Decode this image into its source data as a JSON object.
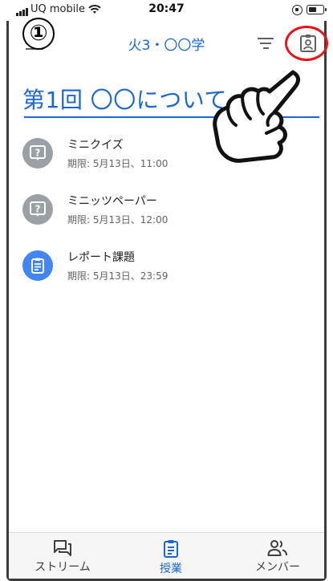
{
  "status_bar": {
    "carrier": "UQ mobile",
    "time": "20:47"
  },
  "annotation": {
    "step_number": "①"
  },
  "app_bar": {
    "class_title": "火3・〇〇学"
  },
  "topic": {
    "title": "第1回 〇〇について"
  },
  "assignments": [
    {
      "title": "ミニクイズ",
      "due": "期限: 5月13日、11:00",
      "icon": "question-icon"
    },
    {
      "title": "ミニッツペーパー",
      "due": "期限: 5月13日、12:00",
      "icon": "question-icon"
    },
    {
      "title": "レポート課題",
      "due": "期限: 5月13日、23:59",
      "icon": "assignment-icon"
    }
  ],
  "bottom_nav": {
    "stream": "ストリーム",
    "classwork": "授業",
    "people": "メンバー"
  },
  "colors": {
    "accent": "#1967d2",
    "grey_icon": "#9aa0a6",
    "blue_icon": "#4285f4",
    "annotation_red": "#e8141c"
  }
}
